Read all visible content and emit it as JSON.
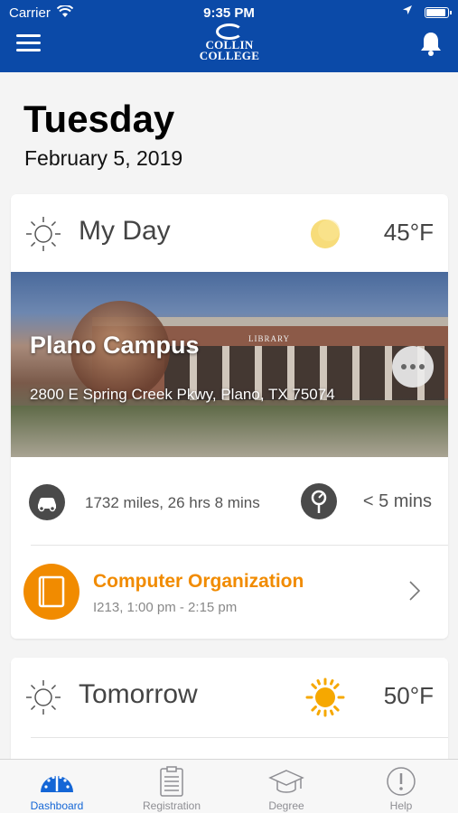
{
  "status_bar": {
    "carrier": "Carrier",
    "time": "9:35 PM"
  },
  "header": {
    "logo_line1": "COLLIN",
    "logo_line2": "COLLEGE",
    "menu_icon": "hamburger-menu-icon",
    "bell_icon": "bell-icon",
    "brand_color": "#0b4aa8"
  },
  "date": {
    "weekday": "Tuesday",
    "full": "February 5, 2019"
  },
  "my_day": {
    "title": "My Day",
    "temperature": "45°F",
    "weather_icon": "moon-icon",
    "campus": {
      "name": "Plano Campus",
      "address": "2800 E Spring Creek Pkwy, Plano, TX 75074",
      "sign": "LIBRARY"
    },
    "drive_text": "1732 miles, 26 hrs 8 mins",
    "walk_text": "< 5 mins",
    "class": {
      "name": "Computer Organization",
      "details": "I213, 1:00 pm - 2:15 pm",
      "accent": "#f18b00"
    }
  },
  "tomorrow": {
    "title": "Tomorrow",
    "temperature": "50°F",
    "weather_icon": "sun-icon"
  },
  "tabs": [
    {
      "label": "Dashboard",
      "icon": "speedometer-icon",
      "active": true
    },
    {
      "label": "Registration",
      "icon": "clipboard-icon",
      "active": false
    },
    {
      "label": "Degree",
      "icon": "graduation-cap-icon",
      "active": false
    },
    {
      "label": "Help",
      "icon": "exclamation-circle-icon",
      "active": false
    }
  ]
}
